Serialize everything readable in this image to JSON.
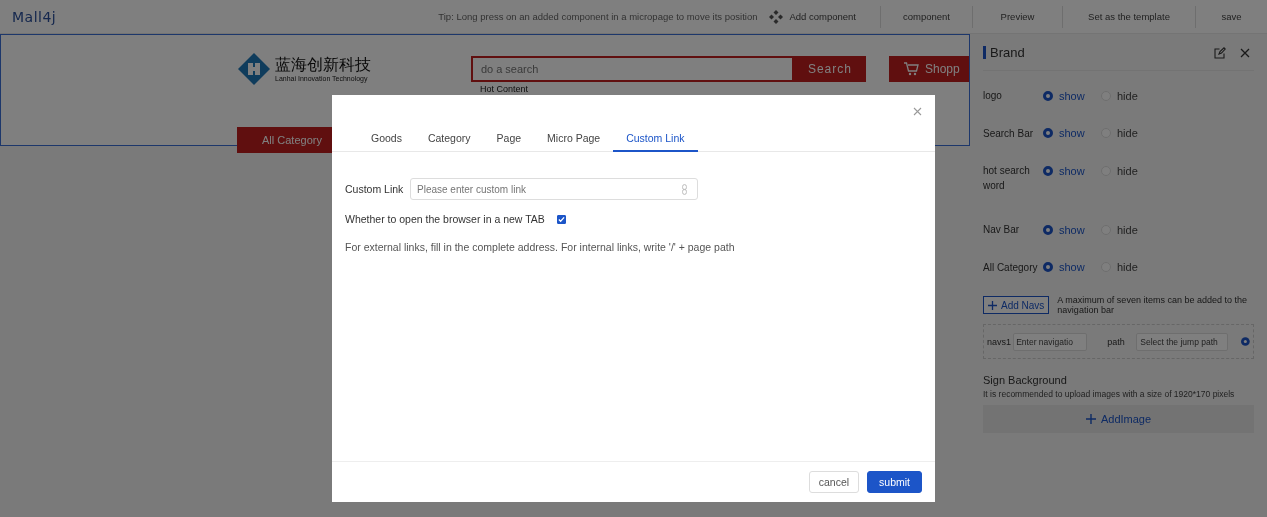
{
  "app": {
    "logo": "Mall4j"
  },
  "toolbar": {
    "tip": "Tip: Long press on an added component in a micropage to move its position",
    "add_component": "Add component",
    "actions": [
      "component",
      "Preview",
      "Set as the template",
      "save"
    ]
  },
  "canvas": {
    "brand": {
      "name_zh": "蓝海创新科技",
      "name_en": "Lanhai Innovation Technology"
    },
    "search": {
      "placeholder": "do a search",
      "button": "Search",
      "hot_label": "Hot Content"
    },
    "cart_button": "Shopp",
    "category_button": "All Category"
  },
  "panel": {
    "title": "Brand",
    "options": [
      {
        "label": "logo",
        "choices": [
          {
            "label": "show",
            "selected": true
          },
          {
            "label": "hide",
            "selected": false
          }
        ]
      },
      {
        "label": "Search Bar",
        "choices": [
          {
            "label": "show",
            "selected": true
          },
          {
            "label": "hide",
            "selected": false
          }
        ]
      },
      {
        "label": "hot search word",
        "choices": [
          {
            "label": "show",
            "selected": true
          },
          {
            "label": "hide",
            "selected": false
          }
        ]
      },
      {
        "label": "Nav Bar",
        "choices": [
          {
            "label": "show",
            "selected": true
          },
          {
            "label": "hide",
            "selected": false
          }
        ]
      },
      {
        "label": "All Category",
        "choices": [
          {
            "label": "show",
            "selected": true
          },
          {
            "label": "hide",
            "selected": false
          }
        ]
      }
    ],
    "add_navs": {
      "button": "Add Navs",
      "hint": "A maximum of seven items can be added to the navigation bar"
    },
    "navs": [
      {
        "label": "navs1",
        "name_placeholder": "Enter navigatio",
        "path_label": "path",
        "path_placeholder": "Select the jump path"
      }
    ],
    "sign": {
      "title": "Sign Background",
      "hint": "It is recommended to upload images with a size of 1920*170 pixels",
      "button": "AddImage"
    }
  },
  "dialog": {
    "tabs": [
      {
        "label": "Goods",
        "selected": false
      },
      {
        "label": "Category",
        "selected": false
      },
      {
        "label": "Page",
        "selected": false
      },
      {
        "label": "Micro Page",
        "selected": false
      },
      {
        "label": "Custom Link",
        "selected": true
      }
    ],
    "field": {
      "label": "Custom Link",
      "placeholder": "Please enter custom link"
    },
    "new_tab": {
      "label": "Whether to open the browser in a new TAB",
      "checked": true
    },
    "note": "For external links, fill in the complete address. For internal links, write '/' + page path",
    "buttons": [
      {
        "label": "cancel",
        "kind": "default"
      },
      {
        "label": "submit",
        "kind": "primary"
      }
    ]
  }
}
